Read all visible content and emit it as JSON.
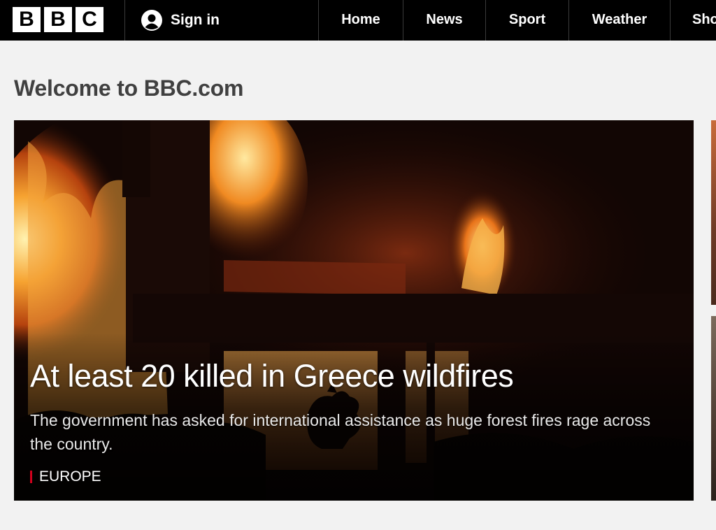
{
  "header": {
    "logo_letters": [
      "B",
      "B",
      "C"
    ],
    "signin_label": "Sign in",
    "nav_items": [
      "Home",
      "News",
      "Sport",
      "Weather",
      "Shop"
    ]
  },
  "page": {
    "title": "Welcome to BBC.com"
  },
  "hero": {
    "headline": "At least 20 killed in Greece wildfires",
    "summary": "The government has asked for international assistance as huge forest fires rage across the country.",
    "tag": "EUROPE"
  },
  "colors": {
    "nav_background": "#000000",
    "page_background": "#f2f2f2",
    "title_text": "#404040",
    "tag_accent": "#d1001c"
  },
  "icons": {
    "signin": "user-icon"
  }
}
